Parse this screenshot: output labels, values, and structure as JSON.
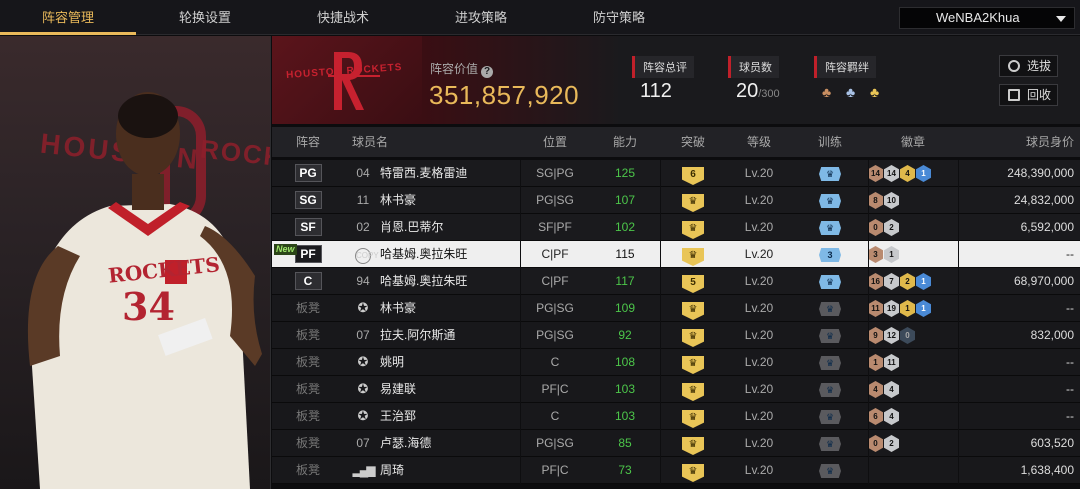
{
  "nav": {
    "tabs": [
      "阵容管理",
      "轮换设置",
      "快捷战术",
      "进攻策略",
      "防守策略"
    ],
    "active": 0,
    "user": "WeNBA2Khua"
  },
  "team": {
    "logo_text": "HOUSTON ROCKETS",
    "value_label": "阵容价值",
    "value": "351,857,920",
    "rating_label": "阵容总评",
    "rating": "112",
    "players_label": "球员数",
    "players": "20",
    "players_max": "/300",
    "bond_label": "阵容羁绊",
    "bond_icons": [
      "bond-bronze-icon",
      "bond-silver-icon",
      "bond-gold-icon"
    ],
    "btn_scout": "选拔",
    "btn_recycle": "回收"
  },
  "player_art": {
    "bg_text_left": "HOUSTON",
    "bg_text_right": "ROCK",
    "jersey_text": "ROCKETS",
    "jersey_number": "34"
  },
  "colors": {
    "accent": "#e9b95a",
    "brand_red": "#c0202a",
    "ability_green": "#4cc64a"
  },
  "table": {
    "headers": [
      "阵容",
      "球员名",
      "位置",
      "能力",
      "突破",
      "等级",
      "训练",
      "徽章",
      "球员身价"
    ],
    "rows": [
      {
        "slot": "PG",
        "num": "04",
        "name": "特雷西.麦格雷迪",
        "pos": "SG|PG",
        "ability": "125",
        "breach": "6",
        "level": "Lv.20",
        "train": "",
        "train_color": "blue",
        "badges": [
          [
            "14",
            "b-bronze"
          ],
          [
            "14",
            "b-silver"
          ],
          [
            "4",
            "b-gold"
          ],
          [
            "1",
            "b-blue"
          ]
        ],
        "value": "248,390,000"
      },
      {
        "slot": "SG",
        "num": "11",
        "name": "林书豪",
        "pos": "PG|SG",
        "ability": "107",
        "breach": "",
        "level": "Lv.20",
        "train": "",
        "train_color": "blue",
        "badges": [
          [
            "8",
            "b-bronze"
          ],
          [
            "10",
            "b-silver"
          ]
        ],
        "value": "24,832,000"
      },
      {
        "slot": "SF",
        "num": "02",
        "name": "肖恩.巴蒂尔",
        "pos": "SF|PF",
        "ability": "102",
        "breach": "",
        "level": "Lv.20",
        "train": "",
        "train_color": "blue",
        "badges": [
          [
            "0",
            "b-bronze"
          ],
          [
            "2",
            "b-silver"
          ]
        ],
        "value": "6,592,000"
      },
      {
        "slot": "PF",
        "num": "COPY",
        "name": "哈基姆.奥拉朱旺",
        "pos": "C|PF",
        "ability": "115",
        "breach": "",
        "level": "Lv.20",
        "train": "3",
        "train_color": "blue",
        "badges": [
          [
            "3",
            "b-bronze"
          ],
          [
            "1",
            "b-silver"
          ]
        ],
        "value": "--",
        "new": "New",
        "hl": true
      },
      {
        "slot": "C",
        "num": "94",
        "name": "哈基姆.奥拉朱旺",
        "pos": "C|PF",
        "ability": "117",
        "breach": "5",
        "level": "Lv.20",
        "train": "",
        "train_color": "blue",
        "badges": [
          [
            "16",
            "b-bronze"
          ],
          [
            "7",
            "b-silver"
          ],
          [
            "2",
            "b-gold"
          ],
          [
            "1",
            "b-blue"
          ]
        ],
        "value": "68,970,000"
      },
      {
        "slot": "板凳",
        "num": "star",
        "name": "林书豪",
        "pos": "PG|SG",
        "ability": "109",
        "breach": "",
        "level": "Lv.20",
        "train": "",
        "train_color": "dark",
        "badges": [
          [
            "11",
            "b-bronze"
          ],
          [
            "19",
            "b-silver"
          ],
          [
            "1",
            "b-gold"
          ],
          [
            "1",
            "b-blue"
          ]
        ],
        "value": "--"
      },
      {
        "slot": "板凳",
        "num": "07",
        "name": "拉夫.阿尔斯通",
        "pos": "PG|SG",
        "ability": "92",
        "breach": "",
        "level": "Lv.20",
        "train": "",
        "train_color": "dark",
        "badges": [
          [
            "9",
            "b-bronze"
          ],
          [
            "12",
            "b-silver"
          ],
          [
            "0",
            "b-dark"
          ]
        ],
        "value": "832,000"
      },
      {
        "slot": "板凳",
        "num": "star",
        "name": "姚明",
        "pos": "C",
        "ability": "108",
        "breach": "",
        "level": "Lv.20",
        "train": "",
        "train_color": "dark",
        "badges": [
          [
            "1",
            "b-bronze"
          ],
          [
            "11",
            "b-silver"
          ]
        ],
        "value": "--"
      },
      {
        "slot": "板凳",
        "num": "star",
        "name": "易建联",
        "pos": "PF|C",
        "ability": "103",
        "breach": "",
        "level": "Lv.20",
        "train": "",
        "train_color": "dark",
        "badges": [
          [
            "4",
            "b-bronze"
          ],
          [
            "4",
            "b-silver"
          ]
        ],
        "value": "--"
      },
      {
        "slot": "板凳",
        "num": "star",
        "name": "王治郅",
        "pos": "C",
        "ability": "103",
        "breach": "",
        "level": "Lv.20",
        "train": "",
        "train_color": "dark",
        "badges": [
          [
            "6",
            "b-bronze"
          ],
          [
            "4",
            "b-silver"
          ]
        ],
        "value": "--"
      },
      {
        "slot": "板凳",
        "num": "07",
        "name": "卢瑟.海德",
        "pos": "PG|SG",
        "ability": "85",
        "breach": "",
        "level": "Lv.20",
        "train": "",
        "train_color": "dark",
        "badges": [
          [
            "0",
            "b-bronze"
          ],
          [
            "2",
            "b-silver"
          ]
        ],
        "value": "603,520"
      },
      {
        "slot": "板凳",
        "num": "bars",
        "name": "周琦",
        "pos": "PF|C",
        "ability": "73",
        "breach": "",
        "level": "Lv.20",
        "train": "",
        "train_color": "dark",
        "badges": [],
        "value": "1,638,400"
      }
    ]
  }
}
